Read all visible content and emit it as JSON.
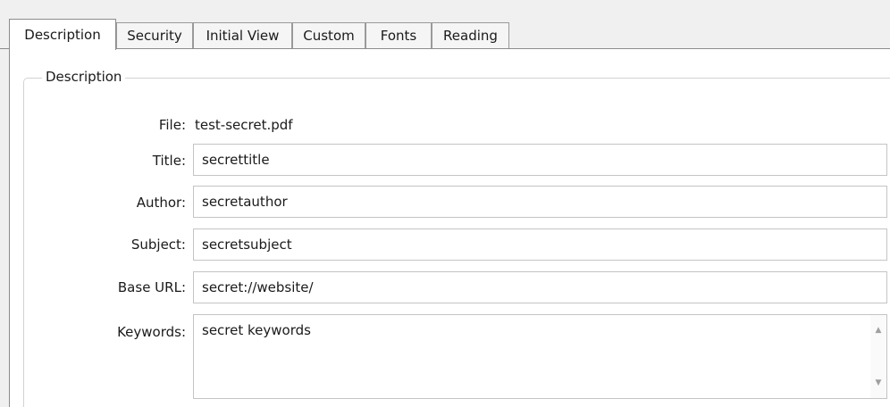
{
  "tabs": [
    {
      "label": "Description",
      "active": true
    },
    {
      "label": "Security",
      "active": false
    },
    {
      "label": "Initial View",
      "active": false
    },
    {
      "label": "Custom",
      "active": false
    },
    {
      "label": "Fonts",
      "active": false
    },
    {
      "label": "Reading",
      "active": false
    }
  ],
  "group": {
    "title": "Description"
  },
  "form": {
    "file_label": "File:",
    "file_value": "test-secret.pdf",
    "title_label": "Title:",
    "title_value": "secrettitle",
    "author_label": "Author:",
    "author_value": "secretauthor",
    "subject_label": "Subject:",
    "subject_value": "secretsubject",
    "base_url_label": "Base URL:",
    "base_url_value": "secret://website/",
    "keywords_label": "Keywords:",
    "keywords_value": "secret keywords"
  },
  "scrollbar": {
    "up_icon": "triangle-up",
    "down_icon": "triangle-down"
  }
}
